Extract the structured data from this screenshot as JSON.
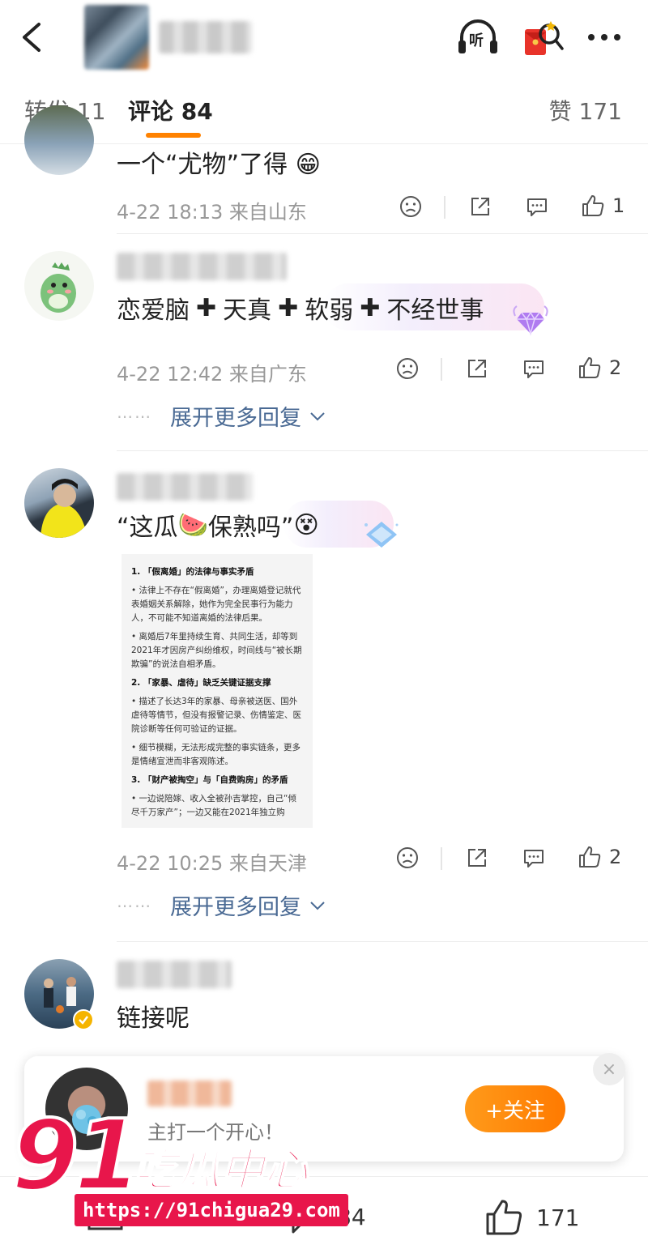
{
  "header": {
    "back_icon": "chevron-left-icon",
    "listen_label": "听",
    "icons": [
      "headphones-icon",
      "red-envelope-icon",
      "more-icon"
    ]
  },
  "tabs": [
    {
      "label": "转发 11"
    },
    {
      "label": "评论 84",
      "active": true
    },
    {
      "label": "赞 171"
    }
  ],
  "comments": [
    {
      "text": "一个“尤物”了得",
      "emoji": "😁",
      "meta": "4-22 18:13 来自山东",
      "likes": "1"
    },
    {
      "text_parts": [
        "恋爱脑",
        "天真",
        "软弱",
        "不经世事"
      ],
      "meta": "4-22 12:42 来自广东",
      "likes": "2",
      "more_replies": "展开更多回复"
    },
    {
      "text_before": "“这瓜",
      "emoji": "🍉",
      "text_after": "保熟吗”",
      "emoji2": "😵",
      "meta": "4-22 10:25 来自天津",
      "likes": "2",
      "more_replies": "展开更多回复",
      "image": {
        "h1": "1. 「假离婚」的法律与事实矛盾",
        "b1": "法律上不存在“假离婚”，办理离婚登记就代表婚姻关系解除，她作为完全民事行为能力人，不可能不知道离婚的法律后果。",
        "b2": "离婚后7年里持续生育、共同生活，却等到2021年才因房产纠纷维权，时间线与“被长期欺骗”的说法自相矛盾。",
        "h2": "2. 「家暴、虐待」缺乏关键证据支撑",
        "b3": "描述了长达3年的家暴、母亲被送医、国外虐待等情节，但没有报警记录、伤情鉴定、医院诊断等任何可验证的证据。",
        "b4": "细节模糊，无法形成完整的事实链条，更多是情绪宣泄而非客观陈述。",
        "h3": "3. 「财产被掏空」与「自费购房」的矛盾",
        "b5": "一边说陪嫁、收入全被孙吉掌控，自己“倾尽千万家产”；一边又能在2021年独立购"
      }
    },
    {
      "text": "链接呢"
    }
  ],
  "popup": {
    "subtitle": "主打一个开心！",
    "follow_label": "+关注",
    "close_label": "×"
  },
  "bottom": {
    "comments_count": "84",
    "likes_count": "171"
  },
  "watermark": {
    "number": "91",
    "brand": "吃瓜中心",
    "url": "https://91chigua29.com"
  },
  "colors": {
    "accent": "#ff8200",
    "link": "#4a6a94",
    "watermark": "#e8164b"
  }
}
